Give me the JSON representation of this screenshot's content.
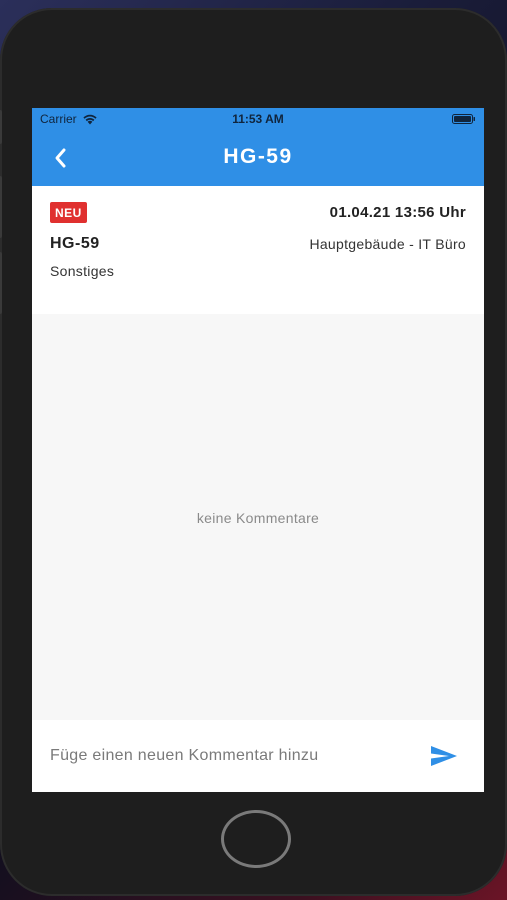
{
  "status_bar": {
    "carrier": "Carrier",
    "time": "11:53 AM",
    "icons": [
      "wifi-icon",
      "battery-icon"
    ]
  },
  "nav": {
    "title": "HG-59",
    "back_icon": "chevron-left-icon",
    "color": "#2f8fe6"
  },
  "ticket": {
    "status_badge": "NEU",
    "badge_color": "#e0302f",
    "datetime": "01.04.21 13:56 Uhr",
    "id": "HG-59",
    "location": "Hauptgebäude - IT Büro",
    "category": "Sonstiges"
  },
  "comments": {
    "empty_text": "keine Kommentare",
    "items": []
  },
  "comment_input": {
    "placeholder": "Füge einen neuen Kommentar hinzu",
    "value": "",
    "send_icon": "send-icon"
  }
}
